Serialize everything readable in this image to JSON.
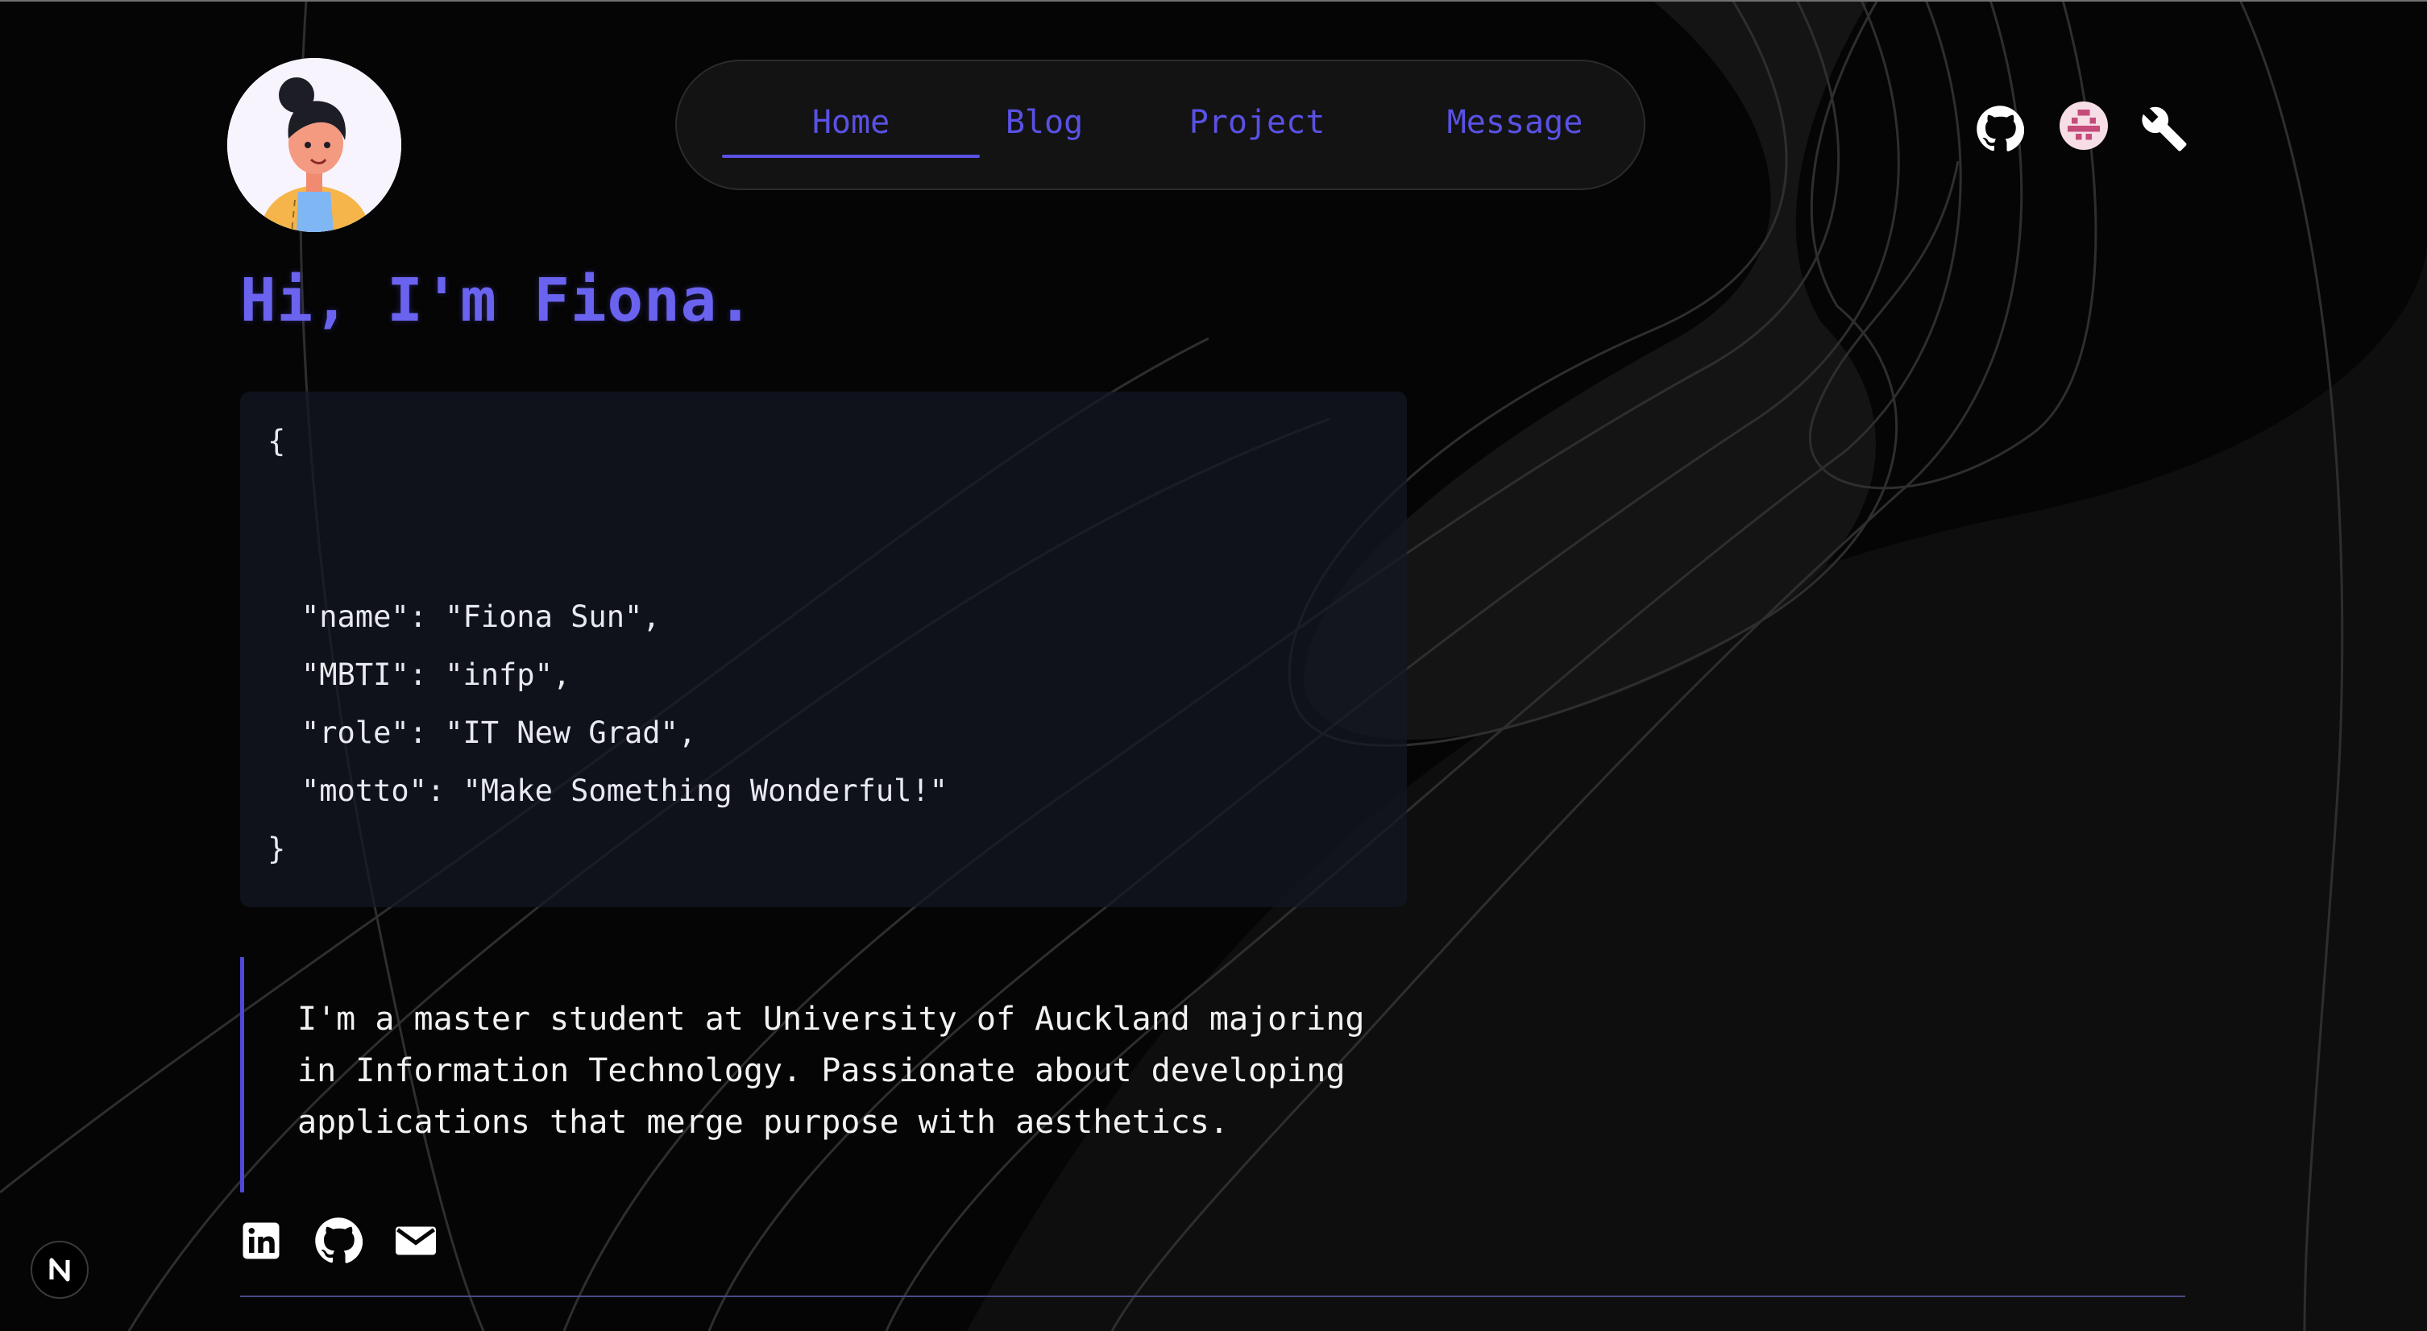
{
  "nav": {
    "items": [
      {
        "label": "Home",
        "active": true
      },
      {
        "label": "Blog",
        "active": false
      },
      {
        "label": "Project",
        "active": false
      },
      {
        "label": "Message",
        "active": false
      }
    ]
  },
  "header": {
    "icons": [
      "github-icon",
      "pixel-avatar-icon",
      "wrench-icon"
    ]
  },
  "hero": {
    "greeting": "Hi, I'm Fiona."
  },
  "code_card": {
    "open_brace": "{",
    "lines": [
      "\"name\": \"Fiona Sun\",",
      "\"MBTI\": \"infp\",",
      "\"role\": \"IT New Grad\",",
      "\"motto\": \"Make Something Wonderful!\""
    ],
    "close_brace": "}"
  },
  "bio": {
    "lines": [
      "I'm a master student at University of Auckland majoring",
      "in Information Technology. Passionate about developing",
      "applications that merge purpose with aesthetics."
    ]
  },
  "social": {
    "icons": [
      "linkedin-icon",
      "github-icon",
      "mail-icon"
    ]
  },
  "badge": {
    "icon": "nextjs-n-icon"
  },
  "colors": {
    "accent": "#5a51e5",
    "heading": "#6a63f0",
    "background": "#050505",
    "code_card_bg": "#141824",
    "text": "#e9e9f0"
  }
}
